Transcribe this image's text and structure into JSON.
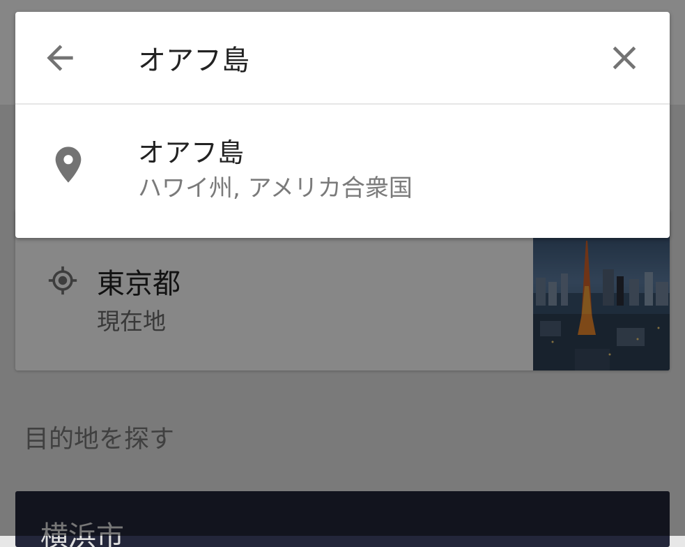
{
  "search": {
    "query": "オアフ島",
    "back_icon": "arrow-back-icon",
    "clear_icon": "close-icon"
  },
  "suggestion": {
    "title": "オアフ島",
    "subtitle": "ハワイ州, アメリカ合衆国",
    "icon": "map-pin-icon",
    "icon_color": "#737373"
  },
  "current_location": {
    "name": "東京都",
    "label": "現在地",
    "icon": "my-location-icon",
    "photo": "tokyo-tower-night-photo"
  },
  "explore": {
    "title": "目的地を探す",
    "first_card": "横浜市"
  },
  "colors": {
    "panel_bg": "#ffffff",
    "scrim": "#000000",
    "icon_gray": "#737373",
    "text_primary": "#222222",
    "text_secondary": "#7a7a7a"
  }
}
